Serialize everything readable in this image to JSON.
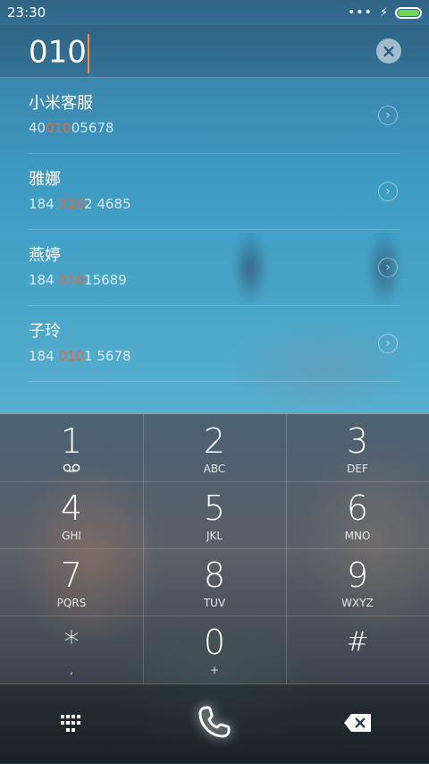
{
  "status_bar": {
    "time": "23:30",
    "signal_dots": "•••",
    "charging_symbol": "⚡"
  },
  "dialer": {
    "input_value": "010",
    "clear_symbol": "×"
  },
  "contacts": [
    {
      "name": "小米客服",
      "num_pre": "40",
      "num_match": "010",
      "num_post": "05678"
    },
    {
      "name": "雅娜",
      "num_pre": "184 ",
      "num_match": "010",
      "num_post": "2 4685"
    },
    {
      "name": "燕婷",
      "num_pre": "184 ",
      "num_match": "010",
      "num_post": "15689"
    },
    {
      "name": "子玲",
      "num_pre": "184 ",
      "num_match": "010",
      "num_post": "1 5678"
    }
  ],
  "keys": [
    {
      "digit": "1",
      "sub": "ᴼᴼ"
    },
    {
      "digit": "2",
      "sub": "ABC"
    },
    {
      "digit": "3",
      "sub": "DEF"
    },
    {
      "digit": "4",
      "sub": "GHI"
    },
    {
      "digit": "5",
      "sub": "JKL"
    },
    {
      "digit": "6",
      "sub": "MNO"
    },
    {
      "digit": "7",
      "sub": "PQRS"
    },
    {
      "digit": "8",
      "sub": "TUV"
    },
    {
      "digit": "9",
      "sub": "WXYZ"
    },
    {
      "digit": "*",
      "sub": ","
    },
    {
      "digit": "0",
      "sub": "+"
    },
    {
      "digit": "#",
      "sub": ""
    }
  ],
  "colors": {
    "highlight": "#e7673a",
    "caret": "#ff8a3d",
    "battery": "#6dd84a"
  },
  "icons": {
    "contact_arrow": "chevron-right-circle-icon",
    "bottom_left": "keypad-grid-icon",
    "bottom_center": "phone-call-icon",
    "bottom_right": "backspace-icon"
  }
}
